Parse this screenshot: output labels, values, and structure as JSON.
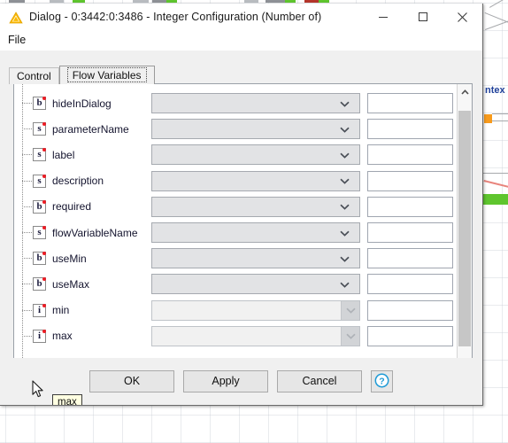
{
  "window": {
    "title": "Dialog - 0:3442:0:3486 - Integer Configuration (Number of)",
    "icon": "knime-warning-triangle-icon",
    "minimize_label": "—",
    "maximize_label": "☐",
    "close_label": "✕"
  },
  "menubar": {
    "items": [
      {
        "label": "File"
      }
    ]
  },
  "tabs": [
    {
      "label": "Control",
      "selected": false
    },
    {
      "label": "Flow Variables",
      "selected": true
    }
  ],
  "flow_variables": {
    "rows": [
      {
        "name": "hideInDialog",
        "type": "b",
        "type_title": "boolean",
        "combo_value": "",
        "combo_enabled": true,
        "text_value": ""
      },
      {
        "name": "parameterName",
        "type": "s",
        "type_title": "string",
        "combo_value": "",
        "combo_enabled": true,
        "text_value": ""
      },
      {
        "name": "label",
        "type": "s",
        "type_title": "string",
        "combo_value": "",
        "combo_enabled": true,
        "text_value": ""
      },
      {
        "name": "description",
        "type": "s",
        "type_title": "string",
        "combo_value": "",
        "combo_enabled": true,
        "text_value": ""
      },
      {
        "name": "required",
        "type": "b",
        "type_title": "boolean",
        "combo_value": "",
        "combo_enabled": true,
        "text_value": ""
      },
      {
        "name": "flowVariableName",
        "type": "s",
        "type_title": "string",
        "combo_value": "",
        "combo_enabled": true,
        "text_value": ""
      },
      {
        "name": "useMin",
        "type": "b",
        "type_title": "boolean",
        "combo_value": "",
        "combo_enabled": true,
        "text_value": ""
      },
      {
        "name": "useMax",
        "type": "b",
        "type_title": "boolean",
        "combo_value": "",
        "combo_enabled": true,
        "text_value": ""
      },
      {
        "name": "min",
        "type": "i",
        "type_title": "integer",
        "combo_value": "",
        "combo_enabled": false,
        "text_value": ""
      },
      {
        "name": "max",
        "type": "i",
        "type_title": "integer",
        "combo_value": "",
        "combo_enabled": false,
        "text_value": ""
      }
    ]
  },
  "tooltip": {
    "text": "max"
  },
  "buttons": {
    "ok": "OK",
    "apply": "Apply",
    "cancel": "Cancel",
    "help": "?"
  },
  "background": {
    "label": "ntex",
    "colors": {
      "accent_orange": "#f89b1c",
      "status_green": "#5fc52e",
      "connector_red": "#e8847c",
      "label_blue": "#20419a"
    }
  },
  "colors": {
    "dialog_bg": "#f0f0f0",
    "field_bg": "#ffffff",
    "combo_bg": "#e2e3e5",
    "combo_disabled_bg": "#f1f1f1",
    "scrollbar_thumb": "#c6c6c6",
    "icon_dot_red": "#ed1c24",
    "help_blue": "#1e9ad6"
  }
}
